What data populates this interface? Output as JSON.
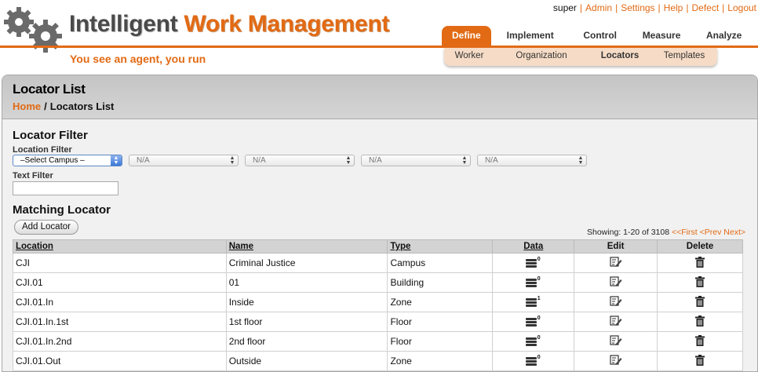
{
  "header": {
    "title_part1": "Intelligent",
    "title_part2": "Work Management",
    "tagline": "You see an agent, you run",
    "user": "super",
    "links": [
      "Admin",
      "Settings",
      "Help",
      "Defect",
      "Logout"
    ]
  },
  "nav": {
    "main_tabs": [
      "Define",
      "Implement",
      "Control",
      "Measure",
      "Analyze"
    ],
    "active_main_tab": "Define",
    "sub_tabs": [
      "Worker",
      "Organization",
      "Locators",
      "Templates"
    ],
    "active_sub_tab": "Locators"
  },
  "page": {
    "title": "Locator List",
    "breadcrumb": {
      "home": "Home",
      "separator": "/",
      "current": "Locators List"
    }
  },
  "filter": {
    "title": "Locator Filter",
    "location_label": "Location Filter",
    "selects": [
      "–Select Campus –",
      "N/A",
      "N/A",
      "N/A",
      "N/A"
    ],
    "text_label": "Text Filter",
    "text_value": ""
  },
  "results": {
    "title": "Matching Locator",
    "add_button": "Add Locator",
    "showing": "Showing: 1-20 of 3108",
    "paging_links": [
      "<<First",
      "<Prev",
      "Next>"
    ],
    "columns": [
      "Location",
      "Name",
      "Type",
      "Data",
      "Edit",
      "Delete"
    ],
    "rows": [
      {
        "location": "CJI",
        "name": "Criminal Justice",
        "type": "Campus",
        "data_count": "0"
      },
      {
        "location": "CJI.01",
        "name": "01",
        "type": "Building",
        "data_count": "0"
      },
      {
        "location": "CJI.01.In",
        "name": "Inside",
        "type": "Zone",
        "data_count": "1"
      },
      {
        "location": "CJI.01.In.1st",
        "name": "1st floor",
        "type": "Floor",
        "data_count": "0"
      },
      {
        "location": "CJI.01.In.2nd",
        "name": "2nd floor",
        "type": "Floor",
        "data_count": "0"
      },
      {
        "location": "CJI.01.Out",
        "name": "Outside",
        "type": "Zone",
        "data_count": "0"
      }
    ]
  },
  "icons": {
    "logo": "gears-logo-icon",
    "data": "stacked-records-icon",
    "edit": "edit-pencil-icon",
    "delete": "trash-can-icon"
  },
  "colors": {
    "accent": "#e26a14",
    "subnav_bg": "#f6dcc6",
    "panel_header": "#c8c8c8",
    "table_header": "#d3d3d3"
  }
}
